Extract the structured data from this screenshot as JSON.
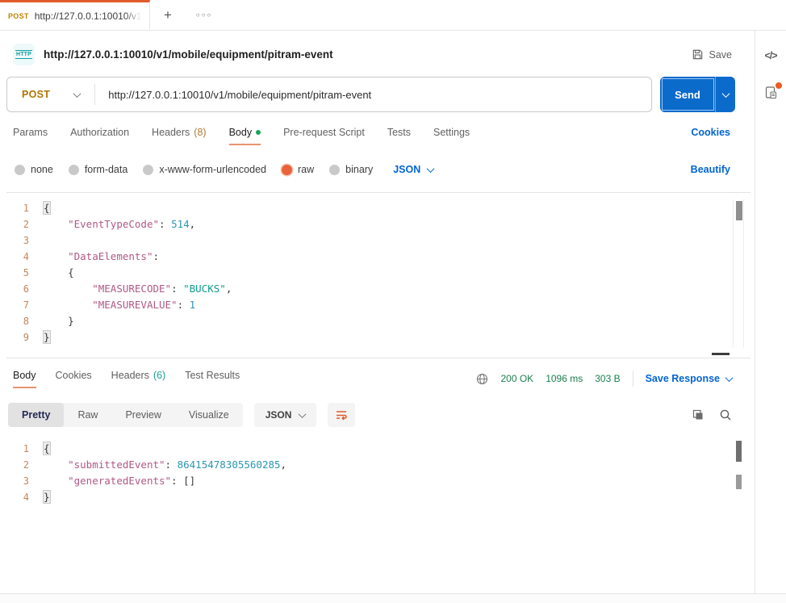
{
  "colors": {
    "accent_orange": "#e55f32",
    "tab_underline_orange": "#e8936f",
    "method_post_amber": "#b07502",
    "link_blue": "#0265d2",
    "send_button_blue": "#0b6bcb",
    "status_green": "#1a7f4b",
    "headers_count_tan": "#b1792f",
    "headers_count_teal": "#1a9e96",
    "body_dot_green": "#18a558",
    "code_key": "#b05987",
    "code_string": "#0f9c8e",
    "code_number": "#2b96b2",
    "line_number_tan": "#c0875f",
    "http_icon_teal": "#0d9f9f",
    "notification_dot_orange": "#ef5b25"
  },
  "tabbar": {
    "method": "POST",
    "url": "http://127.0.0.1:10010/v1",
    "add_icon": "+",
    "more_icon": "○○○"
  },
  "sidebar": {
    "code_icon": "</>"
  },
  "request": {
    "title": "http://127.0.0.1:10010/v1/mobile/equipment/pitram-event",
    "save_label": "Save",
    "method": "POST",
    "url": "http://127.0.0.1:10010/v1/mobile/equipment/pitram-event",
    "send_label": "Send",
    "tabs": {
      "params": "Params",
      "authorization": "Authorization",
      "headers": "Headers",
      "headers_count": "(8)",
      "body": "Body",
      "prerequest": "Pre-request Script",
      "tests": "Tests",
      "settings": "Settings"
    },
    "cookies_link": "Cookies",
    "body_modes": [
      "none",
      "form-data",
      "x-www-form-urlencoded",
      "raw",
      "binary"
    ],
    "body_mode_selected": "raw",
    "body_language": "JSON",
    "beautify_link": "Beautify",
    "editor_lines": [
      [
        [
          "b",
          "{"
        ]
      ],
      [
        [
          "p",
          "    "
        ],
        [
          "k",
          "\"EventTypeCode\""
        ],
        [
          "p",
          ": "
        ],
        [
          "n",
          "514"
        ],
        [
          "p",
          ","
        ]
      ],
      [],
      [
        [
          "p",
          "    "
        ],
        [
          "k",
          "\"DataElements\""
        ],
        [
          "p",
          ":"
        ]
      ],
      [
        [
          "p",
          "    {"
        ]
      ],
      [
        [
          "p",
          "        "
        ],
        [
          "k",
          "\"MEASURECODE\""
        ],
        [
          "p",
          ": "
        ],
        [
          "s",
          "\"BUCKS\""
        ],
        [
          "p",
          ","
        ]
      ],
      [
        [
          "p",
          "        "
        ],
        [
          "k",
          "\"MEASUREVALUE\""
        ],
        [
          "p",
          ": "
        ],
        [
          "n",
          "1"
        ]
      ],
      [
        [
          "p",
          "    }"
        ]
      ],
      [
        [
          "b",
          "}"
        ]
      ]
    ]
  },
  "response": {
    "tabs": {
      "body": "Body",
      "cookies": "Cookies",
      "headers": "Headers",
      "headers_count": "(6)",
      "test_results": "Test Results"
    },
    "status_code": "200 OK",
    "time": "1096 ms",
    "size": "303 B",
    "save_response_label": "Save Response",
    "views": [
      "Pretty",
      "Raw",
      "Preview",
      "Visualize"
    ],
    "view_selected": "Pretty",
    "language": "JSON",
    "editor_lines": [
      [
        [
          "b",
          "{"
        ]
      ],
      [
        [
          "p",
          "    "
        ],
        [
          "k",
          "\"submittedEvent\""
        ],
        [
          "p",
          ": "
        ],
        [
          "n",
          "86415478305560285"
        ],
        [
          "p",
          ","
        ]
      ],
      [
        [
          "p",
          "    "
        ],
        [
          "k",
          "\"generatedEvents\""
        ],
        [
          "p",
          ": "
        ],
        [
          "p",
          "[]"
        ]
      ],
      [
        [
          "b",
          "}"
        ]
      ]
    ]
  }
}
